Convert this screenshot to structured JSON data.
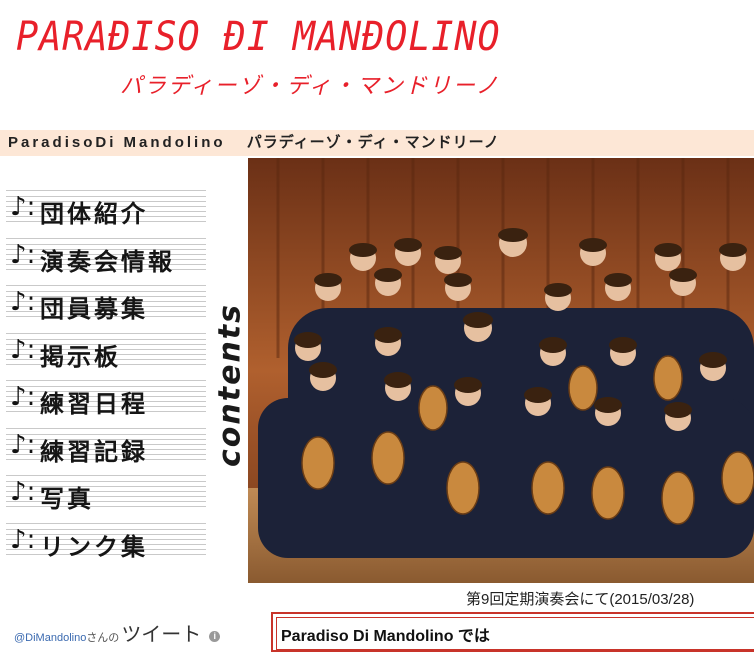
{
  "header": {
    "logo_en": "PARAĐISO ĐI MANĐOLINO",
    "logo_ja": "パラディーゾ・ディ・マンドリーノ"
  },
  "title_bar": {
    "en": "ParadisoDi Mandolino",
    "ja": "パラディーゾ・ディ・マンドリーノ"
  },
  "nav": {
    "note_symbol": "♪:",
    "items": [
      {
        "label": "団体紹介"
      },
      {
        "label": "演奏会情報"
      },
      {
        "label": "団員募集"
      },
      {
        "label": "掲示板"
      },
      {
        "label": "練習日程"
      },
      {
        "label": "練習記録"
      },
      {
        "label": "写真"
      },
      {
        "label": "リンク集"
      }
    ],
    "side_label": "contents"
  },
  "photo": {
    "caption": "第9回定期演奏会にて(2015/03/28)"
  },
  "twitter": {
    "handle": "@DiMandolino",
    "san": "さんの",
    "tweet": "ツイート",
    "info_icon": "i"
  },
  "intro_box": {
    "text": "Paradiso Di Mandolino では"
  },
  "colors": {
    "accent_red": "#e8202a",
    "title_bar_bg": "#fde7d6",
    "box_border": "#c8342a"
  }
}
